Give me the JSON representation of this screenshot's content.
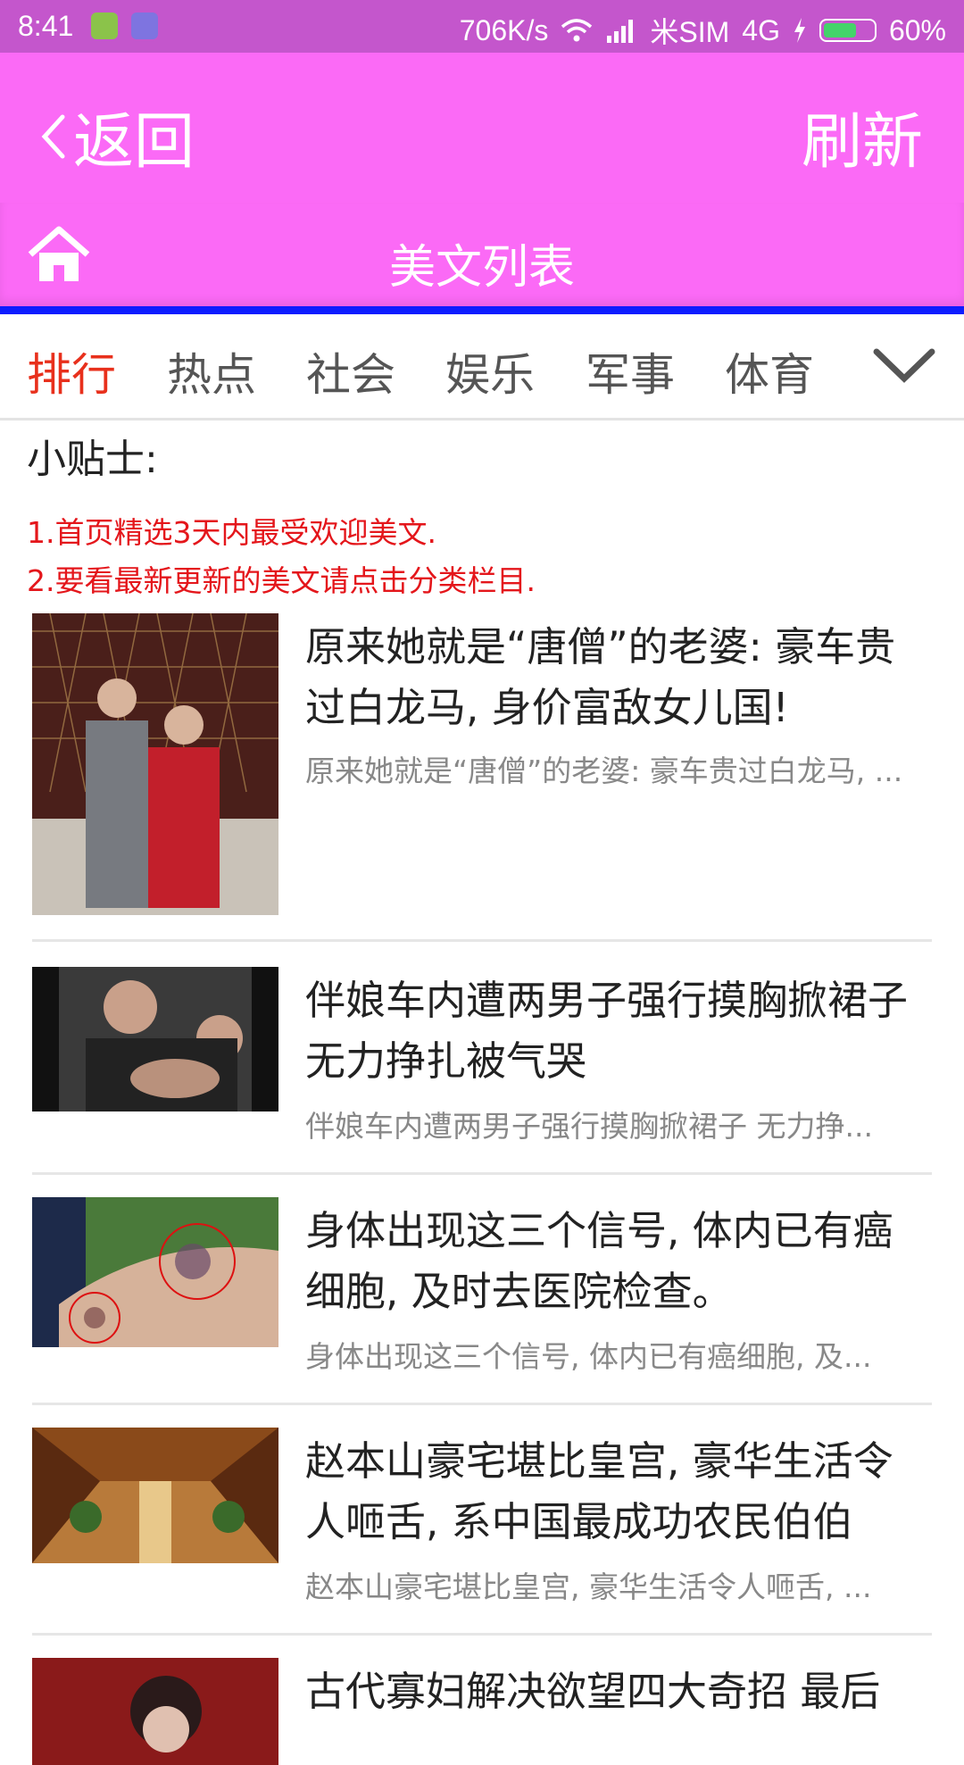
{
  "status_bar": {
    "time": "8:41",
    "network_speed": "706K/s",
    "carrier": "米SIM",
    "network_type": "4G",
    "battery": "60%",
    "icons": [
      "battery-app-icon",
      "app-icon",
      "wifi-icon",
      "signal-icon",
      "charging-icon",
      "battery-icon"
    ]
  },
  "toolbar": {
    "back_label": "返回",
    "refresh_label": "刷新"
  },
  "title_bar": {
    "title": "美文列表",
    "home_icon": "home-icon"
  },
  "tabs": [
    "排行",
    "热点",
    "社会",
    "娱乐",
    "军事",
    "体育"
  ],
  "active_tab": "排行",
  "tips": {
    "heading": "小贴士:",
    "lines": [
      "1.首页精选3天内最受欢迎美文.",
      "2.要看最新更新的美文请点击分类栏目."
    ]
  },
  "articles": [
    {
      "title": "原来她就是“唐僧”的老婆: 豪车贵过白龙马, 身价富敌女儿国!",
      "summary": "原来她就是“唐僧”的老婆: 豪车贵过白龙马, ..."
    },
    {
      "title": "伴娘车内遭两男子强行摸胸掀裙子 无力挣扎被气哭",
      "summary": "伴娘车内遭两男子强行摸胸掀裙子 无力挣..."
    },
    {
      "title": "身体出现这三个信号, 体内已有癌细胞, 及时去医院检查。",
      "summary": "身体出现这三个信号, 体内已有癌细胞, 及..."
    },
    {
      "title": "赵本山豪宅堪比皇宫, 豪华生活令人咂舌, 系中国最成功农民伯伯",
      "summary": "赵本山豪宅堪比皇宫, 豪华生活令人咂舌, ..."
    },
    {
      "title": "古代寡妇解决欲望四大奇招 最后",
      "summary": ""
    }
  ],
  "colors": {
    "status_bar": "#c456cc",
    "header": "#fb6af6",
    "accent_line": "#0d1cff",
    "active_tab": "#e8301c",
    "tip_text": "#e4161b"
  }
}
